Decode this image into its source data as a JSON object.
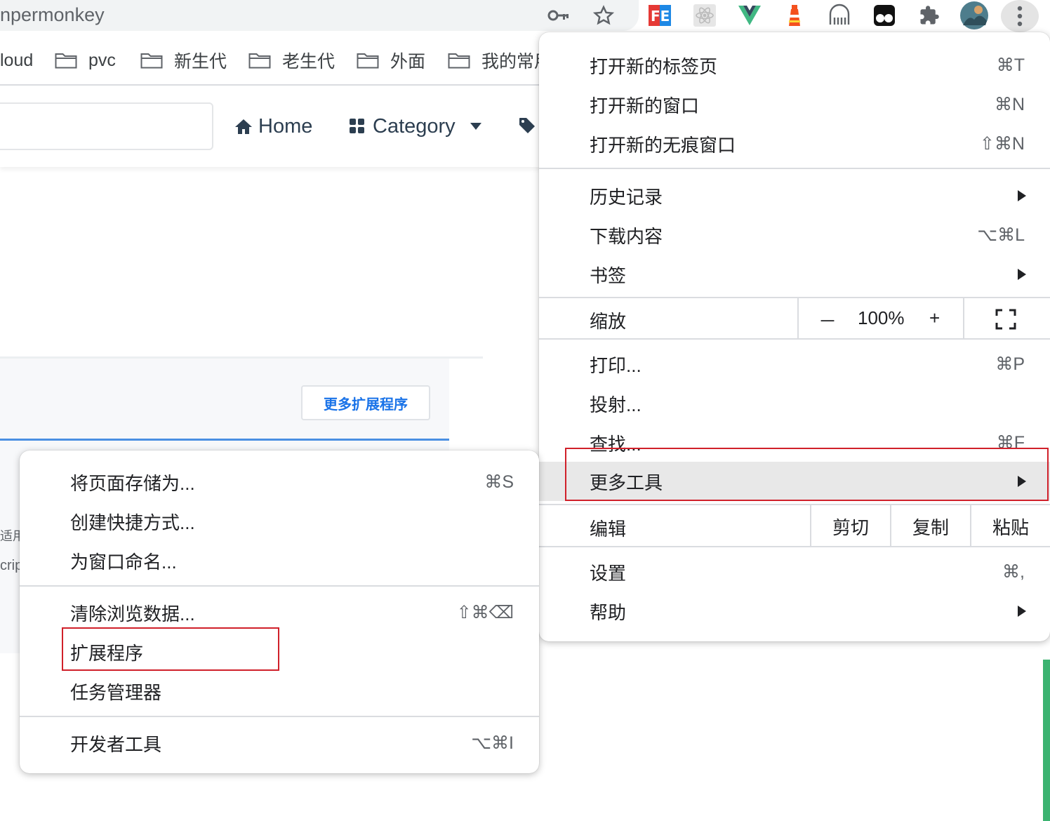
{
  "browser": {
    "omnibox_text": "npermonkey",
    "extensions": [
      "key-icon",
      "star-icon",
      "fe-icon",
      "react-icon",
      "vue-icon",
      "lighthouse-icon",
      "ghost-icon",
      "tampermonkey-icon",
      "puzzle-icon",
      "avatar",
      "more-vert-icon"
    ]
  },
  "bookmarks": [
    "loud",
    "pvc",
    "新生代",
    "老生代",
    "外面",
    "我的常用"
  ],
  "site": {
    "nav_home": "Home",
    "nav_category": "Category",
    "more_extensions_button": "更多扩展程序",
    "side_text_1": "适用",
    "side_text_2": "crip"
  },
  "main_menu": {
    "new_tab": "打开新的标签页",
    "new_tab_sc": "⌘T",
    "new_window": "打开新的窗口",
    "new_window_sc": "⌘N",
    "new_incognito": "打开新的无痕窗口",
    "new_incognito_sc": "⇧⌘N",
    "history": "历史记录",
    "downloads": "下载内容",
    "downloads_sc": "⌥⌘L",
    "bookmarks": "书签",
    "zoom": "缩放",
    "zoom_minus": "－",
    "zoom_value": "100%",
    "zoom_plus": "+",
    "print": "打印...",
    "print_sc": "⌘P",
    "cast": "投射...",
    "find": "查找...",
    "find_sc": "⌘F",
    "more_tools": "更多工具",
    "edit": "编辑",
    "cut": "剪切",
    "copy": "复制",
    "paste": "粘贴",
    "settings": "设置",
    "settings_sc": "⌘,",
    "help": "帮助"
  },
  "sub_menu": {
    "save_page": "将页面存储为...",
    "save_page_sc": "⌘S",
    "create_shortcut": "创建快捷方式...",
    "name_window": "为窗口命名...",
    "clear_data": "清除浏览数据...",
    "clear_data_sc": "⇧⌘⌫",
    "extensions": "扩展程序",
    "task_manager": "任务管理器",
    "dev_tools": "开发者工具",
    "dev_tools_sc": "⌥⌘I"
  },
  "colors": {
    "highlight_border": "#d0202a",
    "menu_hover": "#e8e8e8",
    "link_blue": "#1a73e8"
  }
}
